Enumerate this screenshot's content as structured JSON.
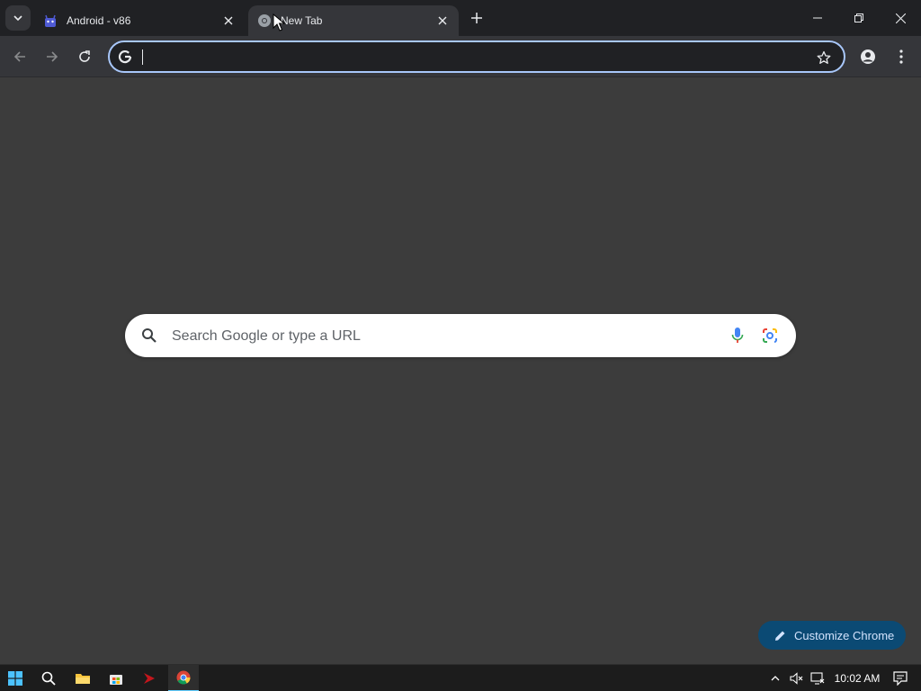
{
  "tabs": [
    {
      "title": "Android - v86",
      "favicon": "android-bugdroid-icon"
    },
    {
      "title": "New Tab",
      "favicon": "chrome-icon"
    }
  ],
  "omnibox": {
    "value": "",
    "placeholder": ""
  },
  "ntp": {
    "search_placeholder": "Search Google or type a URL",
    "customize_label": "Customize Chrome"
  },
  "taskbar": {
    "time": "10:02 AM",
    "apps": [
      "windows-start-icon",
      "search-icon",
      "file-explorer-icon",
      "store-icon",
      "red-app-icon",
      "chrome-icon"
    ]
  },
  "colors": {
    "page_background": "#3c3c3c",
    "tabstrip": "#202124",
    "toolbar": "#35363a",
    "omnibox_focus_ring": "#a8c7fa",
    "customize_button": "#0b4a74"
  }
}
